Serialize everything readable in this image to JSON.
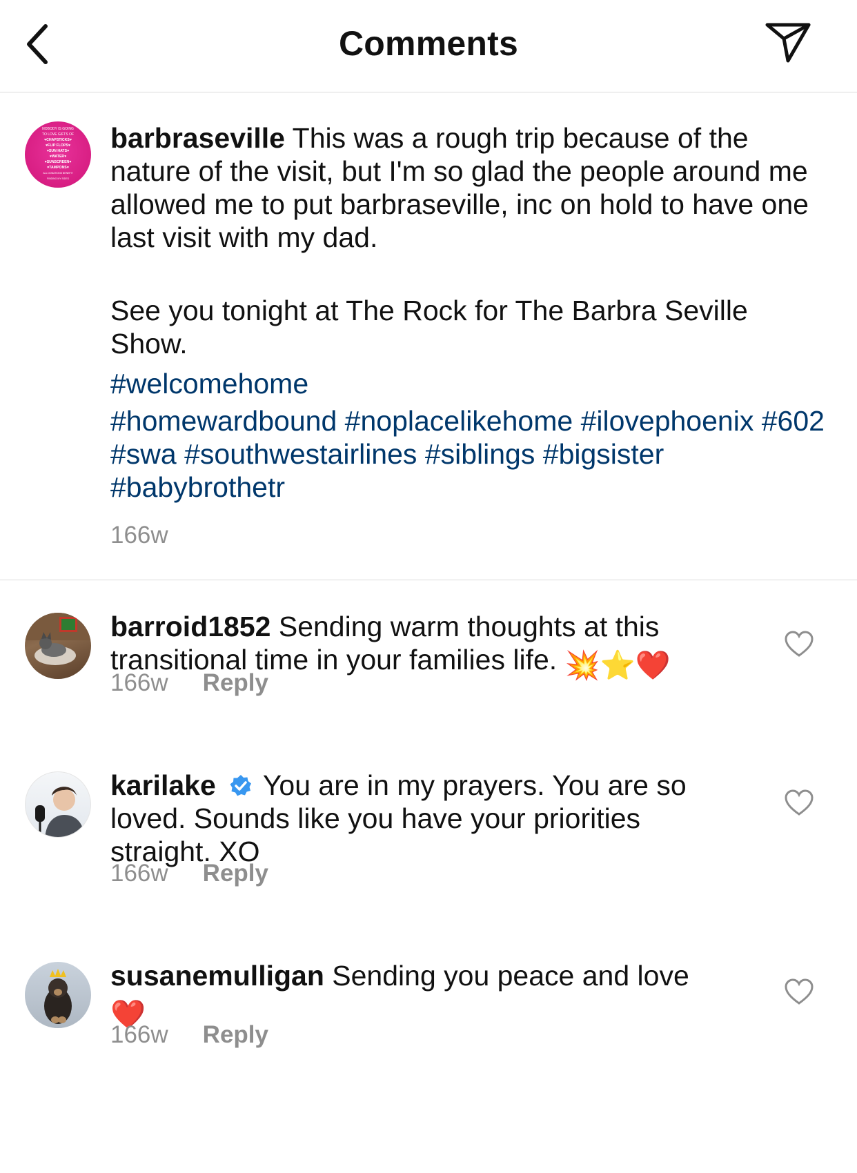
{
  "header": {
    "title": "Comments",
    "back_icon": "chevron-left-icon",
    "share_icon": "paper-plane-icon"
  },
  "caption": {
    "username": "barbraseville",
    "text_main": "This was a rough trip because of the nature of the visit, but I'm so glad the people around me allowed me to put barbraseville, inc on hold to have one last visit with my dad.",
    "text_second": "See you tonight at The Rock for The Barbra Seville Show.",
    "hashtags_line1": [
      "#welcomehome"
    ],
    "hashtags_line2": [
      "#homewardbound",
      "#noplacelikehome",
      "#ilovephoenix",
      "#602",
      "#swa",
      "#southwestairlines",
      "#siblings",
      "#bigsister",
      "#babybrothetr"
    ],
    "time": "166w",
    "avatar_lines": [
      "NOBODY IS GOING",
      "TO LOVE GIFTS OF",
      "♥CHAPSTICKS♥",
      "♥FLIP FLOPS♥",
      "♥SUN HATS♥",
      "♥WATER♥",
      "♥SUNSCREEN♥",
      "♥TAMPONS♥",
      "ALL DONATIONS BENEFIT",
      "FINDING MY SIDES"
    ]
  },
  "comments": [
    {
      "username": "barroid1852",
      "verified": false,
      "text": "Sending warm thoughts at this transitional time in your families life.",
      "emoji": "💥⭐❤️",
      "time": "166w",
      "reply_label": "Reply",
      "heart_icon": "heart-outline-icon"
    },
    {
      "username": "karilake",
      "verified": true,
      "text": "You are in my prayers. You are so loved. Sounds like you have your priorities straight. XO",
      "emoji": "",
      "time": "166w",
      "reply_label": "Reply",
      "heart_icon": "heart-outline-icon"
    },
    {
      "username": "susanemulligan",
      "verified": false,
      "text": "Sending you peace and love",
      "emoji": "❤️",
      "time": "166w",
      "reply_label": "Reply",
      "heart_icon": "heart-outline-icon"
    }
  ],
  "colors": {
    "hashtag": "#00376b",
    "meta": "#8e8e8e",
    "verified": "#3897f0",
    "divider": "#dbdbdb"
  }
}
